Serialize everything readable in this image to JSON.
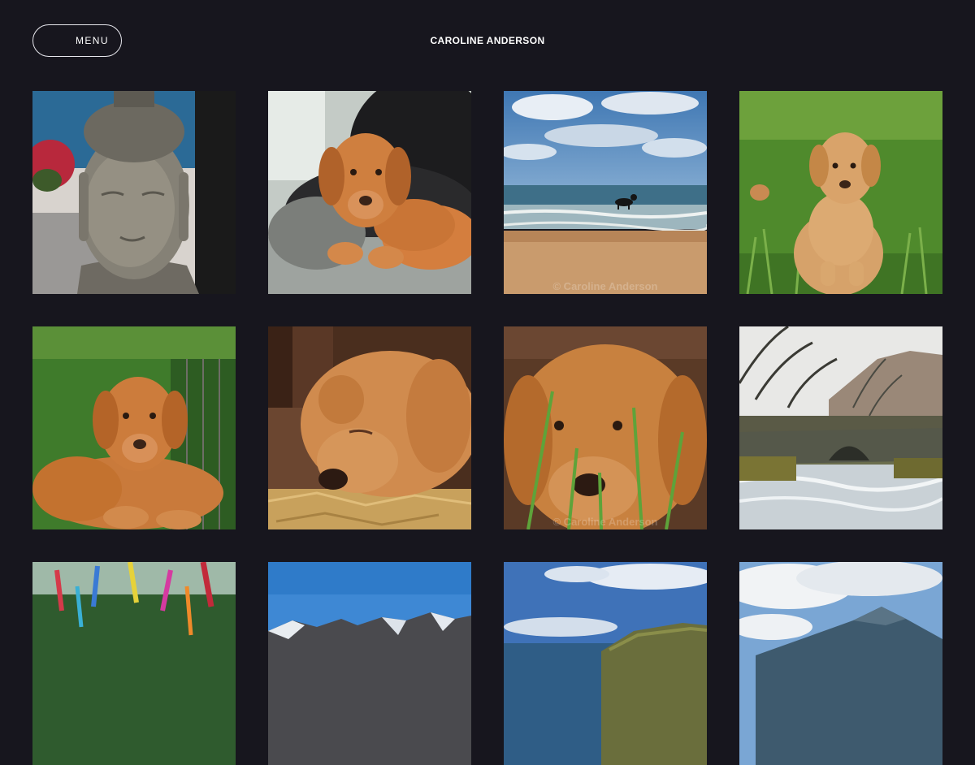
{
  "header": {
    "menu_label": "MENU",
    "site_title": "CAROLINE ANDERSON"
  },
  "gallery": {
    "watermark": "© Caroline Anderson",
    "tiles": [
      {
        "subject": "buddha-statue-by-sea"
      },
      {
        "subject": "puppy-on-blanket"
      },
      {
        "subject": "dog-on-beach",
        "watermark_visible": true
      },
      {
        "subject": "puppy-sitting-in-grass"
      },
      {
        "subject": "puppy-lying-in-grass"
      },
      {
        "subject": "puppy-sleeping-on-straw"
      },
      {
        "subject": "puppy-face-in-grass",
        "watermark_visible": true
      },
      {
        "subject": "stone-bridge-river"
      },
      {
        "subject": "ribbons-on-tree"
      },
      {
        "subject": "snowy-mountains"
      },
      {
        "subject": "coastal-cliffs"
      },
      {
        "subject": "mountain-peak-clouds"
      }
    ]
  }
}
